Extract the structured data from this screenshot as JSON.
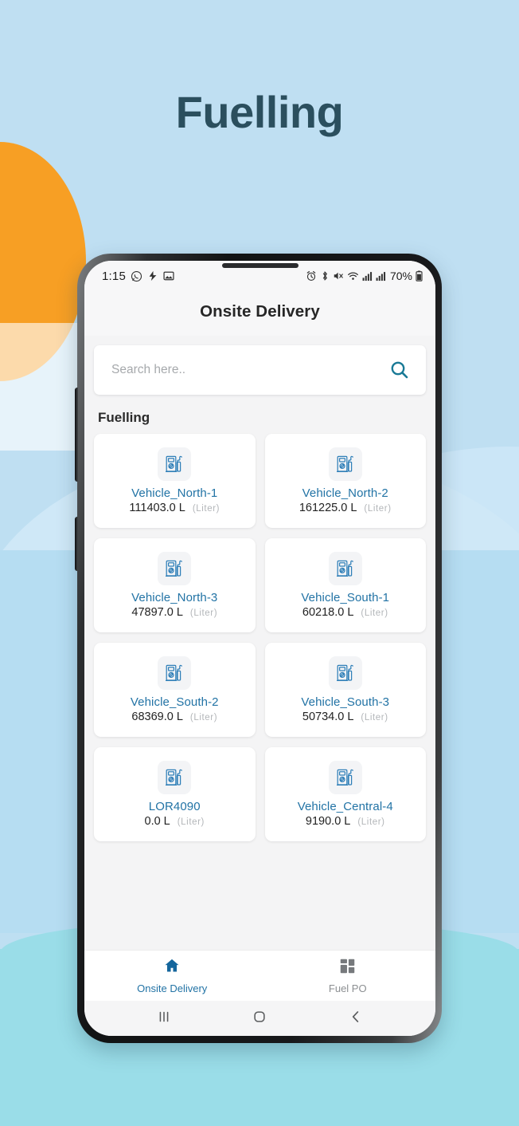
{
  "page": {
    "title": "Fuelling",
    "background_color": "#bfdff2",
    "title_color": "#2b4f5e",
    "accent_color": "#2273a5",
    "sun_color": "#f79f24",
    "water_color": "#9adde8"
  },
  "statusbar": {
    "time": "1:15",
    "left_icons": [
      "whatsapp-icon",
      "notification-icon",
      "image-icon"
    ],
    "right_icons": [
      "alarm-icon",
      "bluetooth-icon",
      "mute-icon",
      "wifi-icon",
      "signal-icon",
      "signal-icon"
    ],
    "battery": "70%"
  },
  "appbar": {
    "title": "Onsite Delivery"
  },
  "search": {
    "placeholder": "Search here..",
    "value": "",
    "icon": "search-icon",
    "icon_color": "#1a7a96"
  },
  "section": {
    "label": "Fuelling"
  },
  "cards": [
    {
      "name": "Vehicle_North-1",
      "value": "111403.0 L",
      "unit": "(Liter)",
      "icon": "fuel-pump-icon"
    },
    {
      "name": "Vehicle_North-2",
      "value": "161225.0 L",
      "unit": "(Liter)",
      "icon": "fuel-pump-icon"
    },
    {
      "name": "Vehicle_North-3",
      "value": "47897.0 L",
      "unit": "(Liter)",
      "icon": "fuel-pump-icon"
    },
    {
      "name": "Vehicle_South-1",
      "value": "60218.0 L",
      "unit": "(Liter)",
      "icon": "fuel-pump-icon"
    },
    {
      "name": "Vehicle_South-2",
      "value": "68369.0 L",
      "unit": "(Liter)",
      "icon": "fuel-pump-icon"
    },
    {
      "name": "Vehicle_South-3",
      "value": "50734.0 L",
      "unit": "(Liter)",
      "icon": "fuel-pump-icon"
    },
    {
      "name": "LOR4090",
      "value": "0.0 L",
      "unit": "(Liter)",
      "icon": "fuel-pump-icon"
    },
    {
      "name": "Vehicle_Central-4",
      "value": "9190.0 L",
      "unit": "(Liter)",
      "icon": "fuel-pump-icon"
    }
  ],
  "bottom_nav": {
    "items": [
      {
        "label": "Onsite Delivery",
        "icon": "home-icon",
        "active": true
      },
      {
        "label": "Fuel PO",
        "icon": "dashboard-icon",
        "active": false
      }
    ]
  },
  "android_nav": {
    "recents": "recents-icon",
    "home": "home-circle-icon",
    "back": "back-icon"
  }
}
